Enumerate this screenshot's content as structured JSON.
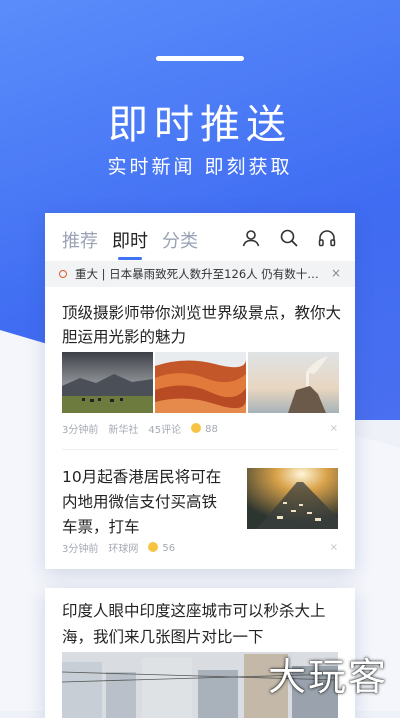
{
  "hero": {
    "title": "即时推送",
    "subtitle": "实时新闻 即刻获取"
  },
  "tabs": [
    {
      "label": "推荐"
    },
    {
      "label": "即时"
    },
    {
      "label": "分类"
    }
  ],
  "header_icons": [
    "user-icon",
    "search-icon",
    "headphones-icon"
  ],
  "ticker": {
    "text": "重大 | 日本暴雨致死人数升至126人 仍有数十…",
    "close": "×"
  },
  "articles": [
    {
      "title": "顶级摄影师带你浏览世界级景点，教你大胆运用光影的魅力",
      "time": "3分钟前",
      "source": "新华社",
      "comments": "45评论",
      "likes": "88",
      "close": "×"
    },
    {
      "title": "10月起香港居民将可在内地用微信支付买高铁车票，打车",
      "time": "3分钟前",
      "source": "环球网",
      "likes": "56",
      "close": "×"
    },
    {
      "title": "印度人眼中印度这座城市可以秒杀大上海，我们来几张图片对比一下"
    }
  ],
  "watermark": "大玩客",
  "colors": {
    "accent": "#3f74f6",
    "hero_bg": "#4f7cf5"
  }
}
